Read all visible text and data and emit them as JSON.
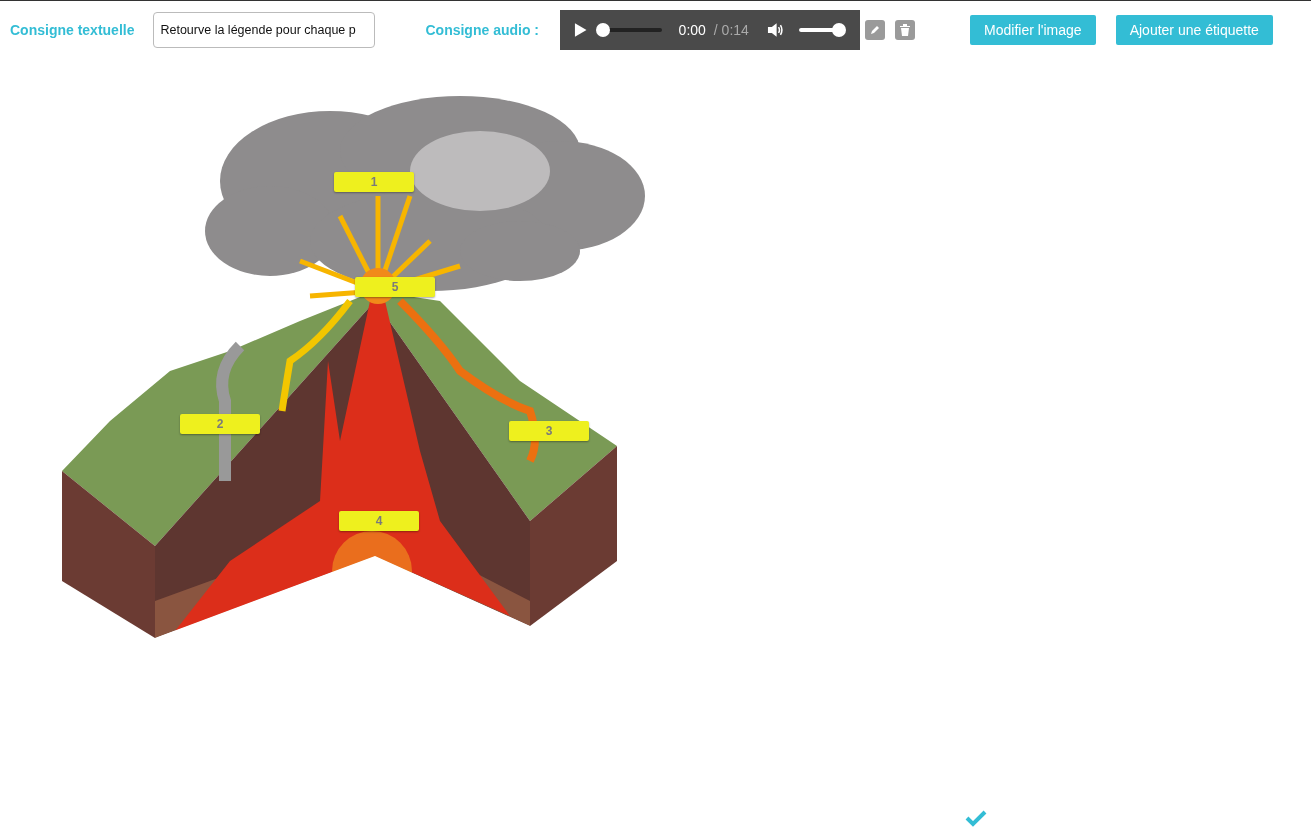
{
  "toolbar": {
    "text_label": "Consigne textuelle",
    "text_value": "Retourve la légende pour chaque p",
    "audio_label": "Consigne audio :"
  },
  "audio_player": {
    "elapsed": "0:00",
    "total": "/ 0:14",
    "progress": {
      "level": 0
    },
    "volume": {
      "level": 1
    }
  },
  "buttons": [
    "Modifier l'image",
    "Ajouter une étiquette"
  ],
  "labels": [
    {
      "text": "1"
    },
    {
      "text": "5"
    },
    {
      "text": "2"
    },
    {
      "text": "3"
    },
    {
      "text": "4"
    }
  ]
}
